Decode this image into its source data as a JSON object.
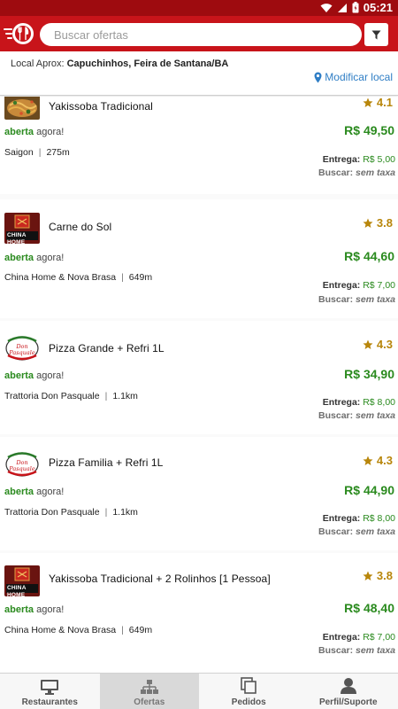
{
  "status": {
    "time": "05:21"
  },
  "header": {
    "search_placeholder": "Buscar ofertas"
  },
  "location": {
    "label": "Local Aprox:",
    "value": "Capuchinhos, Feira de Santana/BA",
    "modify_label": "Modificar local"
  },
  "offers": [
    {
      "title": "Yakissoba Tradicional",
      "rating": "4.1",
      "open_status": "aberta",
      "open_suffix": "agora!",
      "price": "R$ 49,50",
      "restaurant": "Saigon",
      "distance": "275m",
      "delivery_label": "Entrega:",
      "delivery_fee": "R$ 5,00",
      "pickup_label": "Buscar:",
      "pickup_fee": "sem taxa",
      "thumb": "food-photo"
    },
    {
      "title": "Carne do Sol",
      "rating": "3.8",
      "open_status": "aberta",
      "open_suffix": "agora!",
      "price": "R$ 44,60",
      "restaurant": "China Home & Nova Brasa",
      "distance": "649m",
      "delivery_label": "Entrega:",
      "delivery_fee": "R$ 7,00",
      "pickup_label": "Buscar:",
      "pickup_fee": "sem taxa",
      "thumb": "china-home-logo",
      "thumb_text": "CHINA HOME"
    },
    {
      "title": "Pizza Grande + Refri 1L",
      "rating": "4.3",
      "open_status": "aberta",
      "open_suffix": "agora!",
      "price": "R$ 34,90",
      "restaurant": "Trattoria Don Pasquale",
      "distance": "1.1km",
      "delivery_label": "Entrega:",
      "delivery_fee": "R$ 8,00",
      "pickup_label": "Buscar:",
      "pickup_fee": "sem taxa",
      "thumb": "don-pasquale-logo",
      "thumb_text": "Don Pasquale"
    },
    {
      "title": "Pizza Familia + Refri 1L",
      "rating": "4.3",
      "open_status": "aberta",
      "open_suffix": "agora!",
      "price": "R$ 44,90",
      "restaurant": "Trattoria Don Pasquale",
      "distance": "1.1km",
      "delivery_label": "Entrega:",
      "delivery_fee": "R$ 8,00",
      "pickup_label": "Buscar:",
      "pickup_fee": "sem taxa",
      "thumb": "don-pasquale-logo",
      "thumb_text": "Don Pasquale"
    },
    {
      "title": "Yakissoba Tradicional + 2 Rolinhos [1 Pessoa]",
      "rating": "3.8",
      "open_status": "aberta",
      "open_suffix": "agora!",
      "price": "R$ 48,40",
      "restaurant": "China Home & Nova Brasa",
      "distance": "649m",
      "delivery_label": "Entrega:",
      "delivery_fee": "R$ 7,00",
      "pickup_label": "Buscar:",
      "pickup_fee": "sem taxa",
      "thumb": "china-home-logo",
      "thumb_text": "CHINA HOME"
    }
  ],
  "tabs": [
    {
      "label": "Restaurantes",
      "icon": "monitor-icon",
      "active": false
    },
    {
      "label": "Ofertas",
      "icon": "sitemap-icon",
      "active": true
    },
    {
      "label": "Pedidos",
      "icon": "copy-icon",
      "active": false
    },
    {
      "label": "Perfil/Suporte",
      "icon": "user-icon",
      "active": false
    }
  ],
  "colors": {
    "appbar": "#c8141a",
    "statusbar": "#9e0b0f",
    "price_green": "#2a8a1e",
    "star_gold": "#b8860b",
    "link_blue": "#2f7ec5"
  }
}
